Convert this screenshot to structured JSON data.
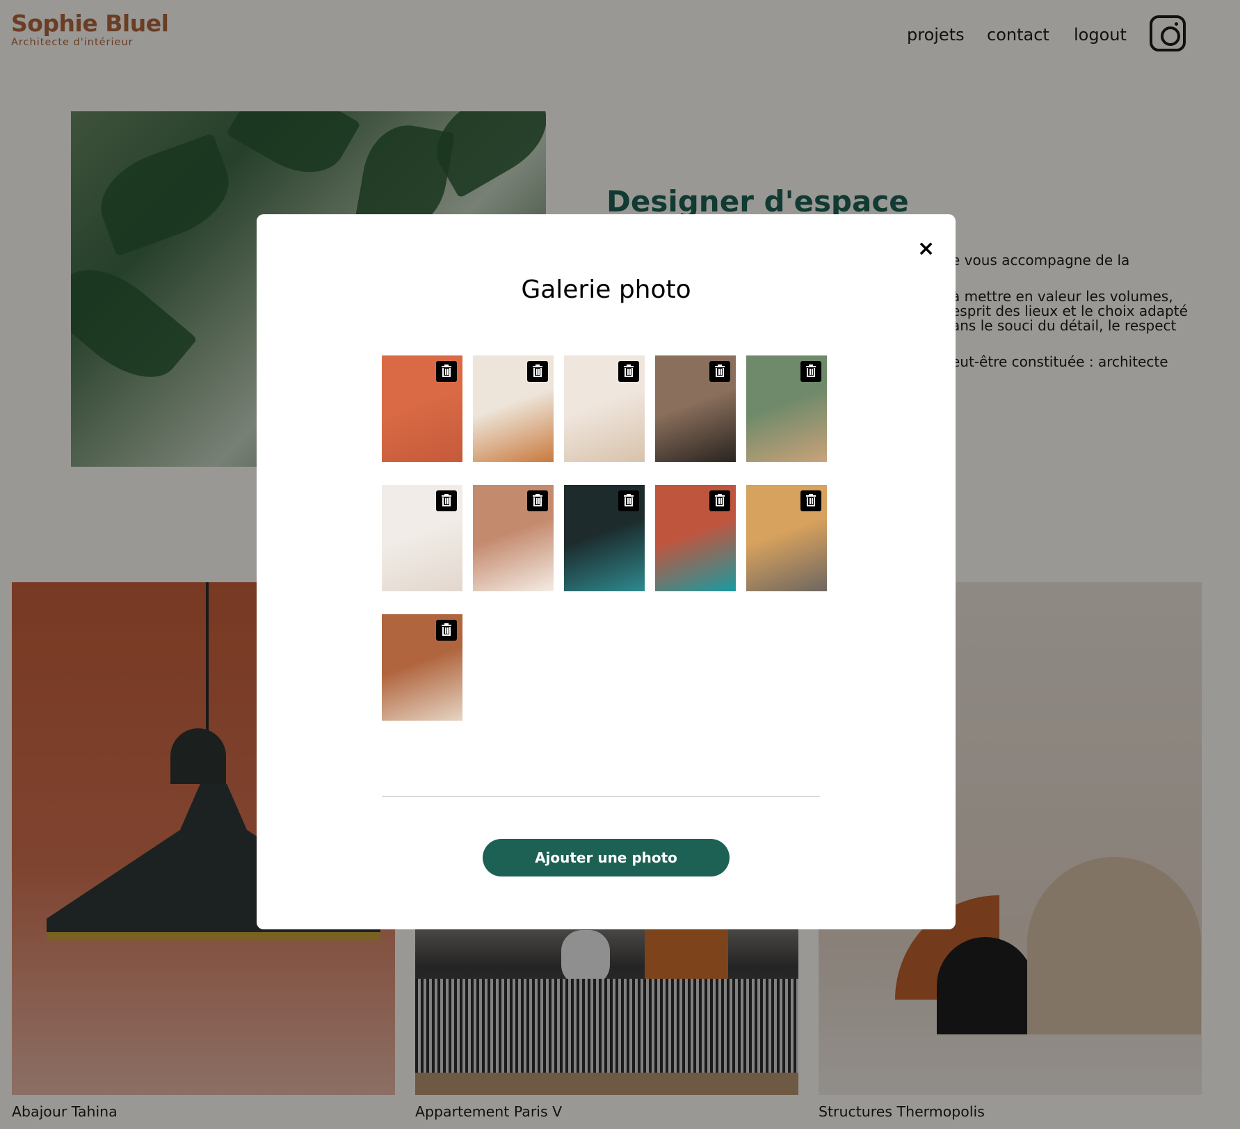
{
  "header": {
    "logo_name": "Sophie Bluel",
    "logo_subtitle": "Architecte d'intérieur",
    "nav": [
      {
        "label": "projets"
      },
      {
        "label": "contact"
      },
      {
        "label": "logout"
      }
    ],
    "instagram_icon": "instagram-icon"
  },
  "intro": {
    "title": "Designer d'espace",
    "paragraph_fragments": [
      "e vous accompagne de la",
      "à mettre en valeur les volumes,\nesprit des lieux et le choix adapté\nans le souci du détail, le respect",
      "eut-être constituée : architecte"
    ]
  },
  "gallery": {
    "captions": [
      "Abajour Tahina",
      "Appartement Paris V",
      "Structures Thermopolis"
    ]
  },
  "modal": {
    "close_label": "×",
    "title": "Galerie photo",
    "delete_icon": "trash-icon",
    "add_button": "Ajouter une photo",
    "photos": [
      {
        "colors": [
          "#d96a45",
          "#c55a3a"
        ]
      },
      {
        "colors": [
          "#ede5da",
          "#c97a3e"
        ]
      },
      {
        "colors": [
          "#efe6dd",
          "#d8c2ab"
        ]
      },
      {
        "colors": [
          "#8a6f5c",
          "#2a2420"
        ]
      },
      {
        "colors": [
          "#6f8a6a",
          "#c9a27a"
        ]
      },
      {
        "colors": [
          "#f1ece7",
          "#e2d7cd"
        ]
      },
      {
        "colors": [
          "#c48a6e",
          "#f4ece4"
        ]
      },
      {
        "colors": [
          "#1d2b2c",
          "#2e8a8f"
        ]
      },
      {
        "colors": [
          "#c0553e",
          "#1a9aa0"
        ]
      },
      {
        "colors": [
          "#d7a15e",
          "#6d6760"
        ]
      },
      {
        "colors": [
          "#b0653e",
          "#e6d4c3"
        ]
      }
    ]
  },
  "colors": {
    "accent": "#1d6154",
    "brand": "#b1663c",
    "background": "#fffef8"
  }
}
